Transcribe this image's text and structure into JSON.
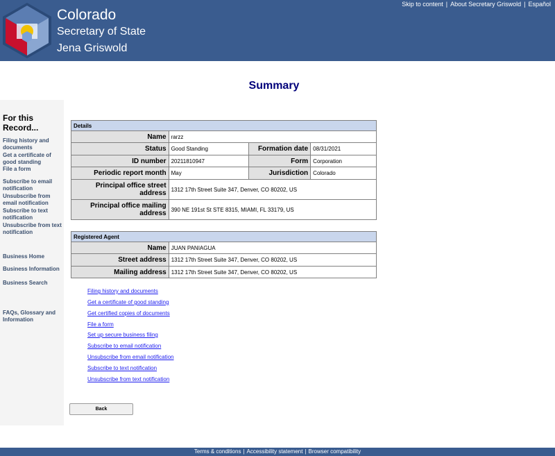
{
  "header": {
    "brand_line1": "Colorado",
    "brand_line2": "Secretary of State",
    "brand_line3": "Jena Griswold",
    "skip_link": "Skip to content",
    "about_link": "About Secretary Griswold",
    "espanol_link": "Español",
    "separator": "|"
  },
  "page": {
    "title": "Summary"
  },
  "sidebar": {
    "heading": "For this Record...",
    "items": [
      "Filing history and documents",
      "Get a certificate of good standing",
      "File a form",
      "Subscribe to email notification",
      "Unsubscribe from email notification",
      "Subscribe to text notification",
      "Unsubscribe from text notification",
      "Business Home",
      "Business Information",
      "Business Search",
      "FAQs, Glossary and Information"
    ]
  },
  "details": {
    "section_title": "Details",
    "name_label": "Name",
    "name_value": "rarzz",
    "status_label": "Status",
    "status_value": "Good Standing",
    "formation_label": "Formation date",
    "formation_value": "08/31/2021",
    "id_label": "ID number",
    "id_value": "20211810947",
    "form_label": "Form",
    "form_value": "Corporation",
    "periodic_label": "Periodic report month",
    "periodic_value": "May",
    "jurisdiction_label": "Jurisdiction",
    "jurisdiction_value": "Colorado",
    "principal_street_label": "Principal office street address",
    "principal_street_value": "1312 17th Street Suite 347, Denver, CO 80202, US",
    "principal_mailing_label": "Principal office mailing address",
    "principal_mailing_value": "390 NE 191st St STE 8315, MIAMI, FL 33179, US"
  },
  "agent": {
    "section_title": "Registered Agent",
    "name_label": "Name",
    "name_value": "JUAN PANIAGUA",
    "street_label": "Street address",
    "street_value": "1312 17th Street Suite 347, Denver, CO 80202, US",
    "mailing_label": "Mailing address",
    "mailing_value": "1312 17th Street Suite 347, Denver, CO 80202, US"
  },
  "links": [
    "Filing history and documents",
    "Get a certificate of good standing",
    "Get certified copies of documents",
    "File a form",
    "Set up secure business filing",
    "Subscribe to email notification",
    "Unsubscribe from email notification",
    "Subscribe to text notification",
    "Unsubscribe from text notification"
  ],
  "back_button": "Back",
  "footer": {
    "terms": "Terms & conditions",
    "accessibility": "Accessibility statement",
    "browser": "Browser compatibility",
    "separator": "|"
  },
  "colors": {
    "header_bg": "#3a5c8f",
    "section_header_bg": "#c9d6ec",
    "label_bg": "#e1e1e1",
    "title_color": "#00007a",
    "link_color": "#1a1aee"
  }
}
